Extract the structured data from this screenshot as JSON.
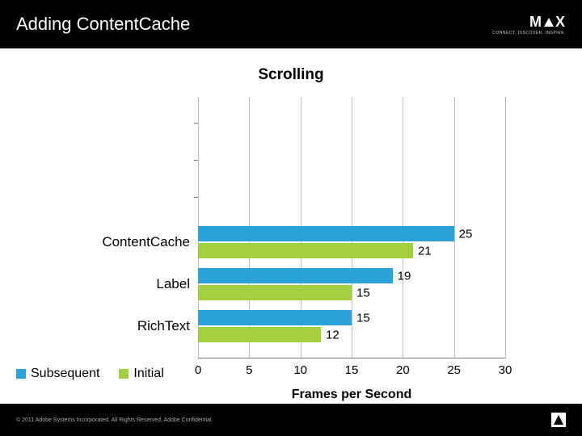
{
  "header": {
    "title": "Adding ContentCache",
    "brand_main": "MAX",
    "brand_sub": "CONNECT. DISCOVER. INSPIRE."
  },
  "footer": {
    "copyright": "© 2011 Adobe Systems Incorporated. All Rights Reserved. Adobe Confidential."
  },
  "chart_data": {
    "type": "bar",
    "orientation": "horizontal",
    "title": "Scrolling",
    "xlabel": "Frames per Second",
    "ylabel": "",
    "xlim": [
      0,
      30
    ],
    "x_ticks": [
      0,
      5,
      10,
      15,
      20,
      25,
      30
    ],
    "categories": [
      "ContentCache",
      "Label",
      "RichText"
    ],
    "series": [
      {
        "name": "Subsequent",
        "color": "#2aa3d9",
        "values": [
          25,
          19,
          15
        ]
      },
      {
        "name": "Initial",
        "color": "#a5d03e",
        "values": [
          21,
          15,
          12
        ]
      }
    ],
    "legend_position": "bottom-left",
    "grid": true
  },
  "legend": {
    "subsequent": "Subsequent",
    "initial": "Initial"
  },
  "ticks": {
    "t0": "0",
    "t5": "5",
    "t10": "10",
    "t15": "15",
    "t20": "20",
    "t25": "25",
    "t30": "30"
  },
  "cats": {
    "c0": "ContentCache",
    "c1": "Label",
    "c2": "RichText"
  },
  "vals": {
    "c0_sub": "25",
    "c0_ini": "21",
    "c1_sub": "19",
    "c1_ini": "15",
    "c2_sub": "15",
    "c2_ini": "12"
  }
}
